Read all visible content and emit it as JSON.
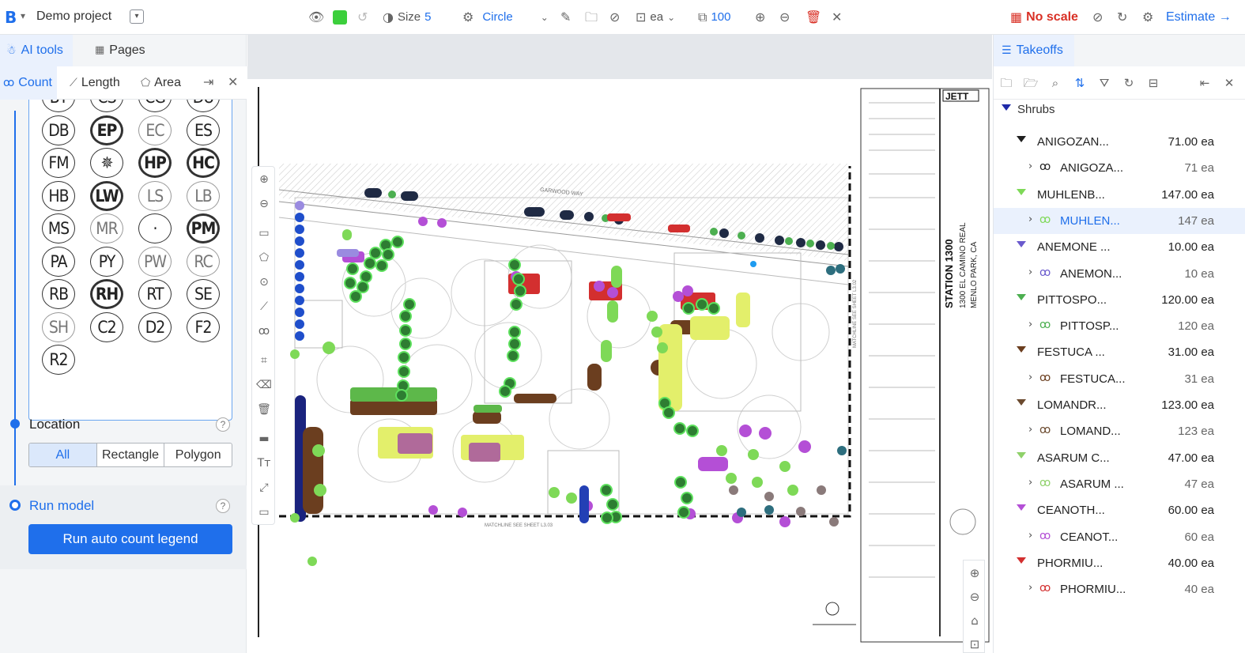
{
  "topbar": {
    "logo": "B",
    "project_name": "Demo project",
    "size_label": "Size",
    "size_value": "5",
    "shape": "Circle",
    "unit": "ea",
    "zoom": "100",
    "no_scale": "No scale",
    "estimate": "Estimate →"
  },
  "left": {
    "tab_ai": "AI tools",
    "tab_pages": "Pages",
    "sub_count": "Count",
    "sub_length": "Length",
    "sub_area": "Area",
    "legend_symbols": [
      [
        "BT",
        "CS",
        "CG",
        "DU"
      ],
      [
        "DB",
        "EP",
        "EC",
        "ES"
      ],
      [
        "FM",
        "✵",
        "HP",
        "HC"
      ],
      [
        "HB",
        "LW",
        "LS",
        "LB"
      ],
      [
        "MS",
        "MR",
        "·",
        "PM"
      ],
      [
        "PA",
        "PY",
        "PW",
        "RC"
      ],
      [
        "RB",
        "RH",
        "RT",
        "SE"
      ],
      [
        "SH",
        "C2",
        "D2",
        "F2"
      ],
      [
        "R2"
      ]
    ],
    "location_label": "Location",
    "location_options": [
      "All",
      "Rectangle",
      "Polygon"
    ],
    "location_selected": "All",
    "run_model_label": "Run model",
    "run_button": "Run auto count legend",
    "help": "?"
  },
  "drawing": {
    "station_title": "STATION 1300",
    "station_address": "1300 EL CAMINO REAL",
    "station_city": "MENLO PARK, CA",
    "logo": "JETT",
    "street_label": "GARWOOD WAY",
    "matchline_left": "MATCHLINE SEE SHEET L3.02",
    "matchline_bottom": "MATCHLINE SEE SHEET L3.03"
  },
  "right": {
    "tab_takeoffs": "Takeoffs",
    "group": "Shrubs",
    "items": [
      {
        "name": "ANIGOZAN...",
        "qty": "71.00 ea",
        "child": "ANIGOZA...",
        "child_qty": "71 ea",
        "color": "#1f1f1f"
      },
      {
        "name": "MUHLENB...",
        "qty": "147.00 ea",
        "child": "MUHLEN...",
        "child_qty": "147 ea",
        "color": "#7ed957",
        "selected": true
      },
      {
        "name": "ANEMONE ...",
        "qty": "10.00 ea",
        "child": "ANEMON...",
        "child_qty": "10 ea",
        "color": "#6a5acd"
      },
      {
        "name": "PITTOSPO...",
        "qty": "120.00 ea",
        "child": "PITTOSP...",
        "child_qty": "120 ea",
        "color": "#4caf50"
      },
      {
        "name": "FESTUCA ...",
        "qty": "31.00 ea",
        "child": "FESTUCA...",
        "child_qty": "31 ea",
        "color": "#6b3e1f"
      },
      {
        "name": "LOMANDR...",
        "qty": "123.00 ea",
        "child": "LOMAND...",
        "child_qty": "123 ea",
        "color": "#6b4a2f"
      },
      {
        "name": "ASARUM C...",
        "qty": "47.00 ea",
        "child": "ASARUM ...",
        "child_qty": "47 ea",
        "color": "#8fd16a"
      },
      {
        "name": "CEANOTH...",
        "qty": "60.00 ea",
        "child": "CEANOT...",
        "child_qty": "60 ea",
        "color": "#b44fd6"
      },
      {
        "name": "PHORMIU...",
        "qty": "40.00 ea",
        "child": "PHORMIU...",
        "child_qty": "40 ea",
        "color": "#d32f2f"
      }
    ]
  },
  "colors": {
    "accent": "#1f6feb",
    "danger": "#d93025",
    "swatch": "#3ccf3c"
  }
}
